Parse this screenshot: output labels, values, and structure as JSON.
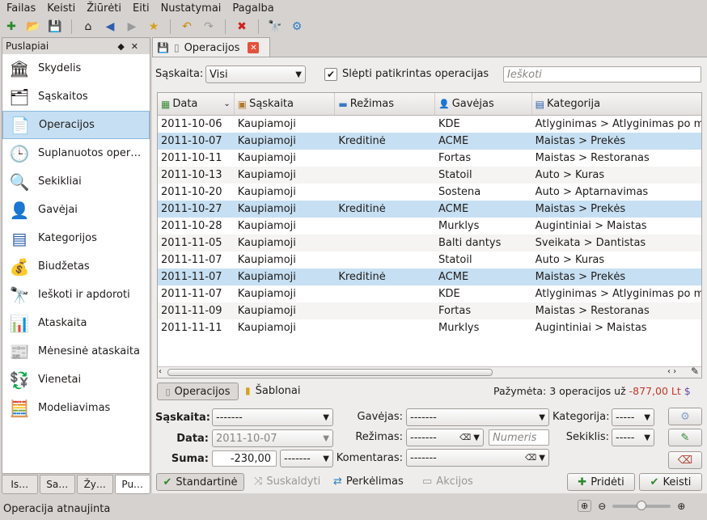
{
  "menu": [
    "Failas",
    "Keisti",
    "Žiūrėti",
    "Eiti",
    "Nustatymai",
    "Pagalba"
  ],
  "sidebar": {
    "title": "Puslapiai",
    "items": [
      {
        "label": "Skydelis",
        "icon": "🏛"
      },
      {
        "label": "Sąskaitos",
        "icon": "🗂"
      },
      {
        "label": "Operacijos",
        "icon": "📄"
      },
      {
        "label": "Suplanuotos oper…",
        "icon": "🕒"
      },
      {
        "label": "Sekikliai",
        "icon": "🔍"
      },
      {
        "label": "Gavėjai",
        "icon": "👤"
      },
      {
        "label": "Kategorijos",
        "icon": "▤"
      },
      {
        "label": "Biudžetas",
        "icon": "💰"
      },
      {
        "label": "Ieškoti ir apdoroti",
        "icon": "🔭"
      },
      {
        "label": "Ataskaita",
        "icon": "📊"
      },
      {
        "label": "Mėnesinė ataskaita",
        "icon": "📰"
      },
      {
        "label": "Vienetai",
        "icon": "💱"
      },
      {
        "label": "Modeliavimas",
        "icon": "🧮"
      }
    ],
    "tabs": [
      "Is…",
      "Sa…",
      "Žy…",
      "Pu…"
    ]
  },
  "doctab": {
    "label": "Operacijos"
  },
  "filter": {
    "account_label": "Sąskaita:",
    "account_value": "Visi",
    "hide_label": "Slėpti patikrintas operacijas",
    "search_placeholder": "Ieškoti"
  },
  "table": {
    "headers": [
      "Data",
      "Sąskaita",
      "Režimas",
      "Gavėjas",
      "Kategorija"
    ],
    "rows": [
      [
        "2011-10-06",
        "Kaupiamoji",
        "",
        "KDE",
        "Atlyginimas > Atlyginimas po m"
      ],
      [
        "2011-10-07",
        "Kaupiamoji",
        "Kreditinė",
        "ACME",
        "Maistas > Prekės"
      ],
      [
        "2011-10-11",
        "Kaupiamoji",
        "",
        "Fortas",
        "Maistas > Restoranas"
      ],
      [
        "2011-10-13",
        "Kaupiamoji",
        "",
        "Statoil",
        "Auto > Kuras"
      ],
      [
        "2011-10-20",
        "Kaupiamoji",
        "",
        "Sostena",
        "Auto > Aptarnavimas"
      ],
      [
        "2011-10-27",
        "Kaupiamoji",
        "Kreditinė",
        "ACME",
        "Maistas > Prekės"
      ],
      [
        "2011-10-28",
        "Kaupiamoji",
        "",
        "Murklys",
        "Augintiniai > Maistas"
      ],
      [
        "2011-11-05",
        "Kaupiamoji",
        "",
        "Balti dantys",
        "Sveikata > Dantistas"
      ],
      [
        "2011-11-07",
        "Kaupiamoji",
        "",
        "Statoil",
        "Auto > Kuras"
      ],
      [
        "2011-11-07",
        "Kaupiamoji",
        "Kreditinė",
        "ACME",
        "Maistas > Prekės"
      ],
      [
        "2011-11-07",
        "Kaupiamoji",
        "",
        "KDE",
        "Atlyginimas > Atlyginimas po m"
      ],
      [
        "2011-11-09",
        "Kaupiamoji",
        "",
        "Fortas",
        "Maistas > Restoranas"
      ],
      [
        "2011-11-11",
        "Kaupiamoji",
        "",
        "Murklys",
        "Augintiniai > Maistas"
      ]
    ],
    "selected": [
      1,
      5,
      9
    ]
  },
  "bottomtabs": {
    "ops": "Operacijos",
    "templates": "Šablonai",
    "selected_text": "Pažymėta: 3 operacijos už",
    "selected_amount": "-877,00 Lt"
  },
  "form": {
    "account_label": "Sąskaita:",
    "account_value": "-------",
    "date_label": "Data:",
    "date_value": "2011-10-07",
    "sum_label": "Suma:",
    "sum_value": "-230,00",
    "sum_unit": "-------",
    "payee_label": "Gavėjas:",
    "payee_value": "-------",
    "mode_label": "Režimas:",
    "mode_value": "-------",
    "number_placeholder": "Numeris",
    "comment_label": "Komentaras:",
    "comment_value": "-------",
    "category_label": "Kategorija:",
    "category_value": "-----",
    "tracker_label": "Sekiklis:",
    "tracker_value": "-----"
  },
  "modes": {
    "standard": "Standartinė",
    "split": "Suskaldyti",
    "transfer": "Perkėlimas",
    "shares": "Akcijos"
  },
  "actions": {
    "add": "Pridėti",
    "modify": "Keisti"
  },
  "status": "Operacija atnaujinta",
  "colors": {
    "selection": "#c6dff2",
    "amount_negative": "#c0392b"
  }
}
